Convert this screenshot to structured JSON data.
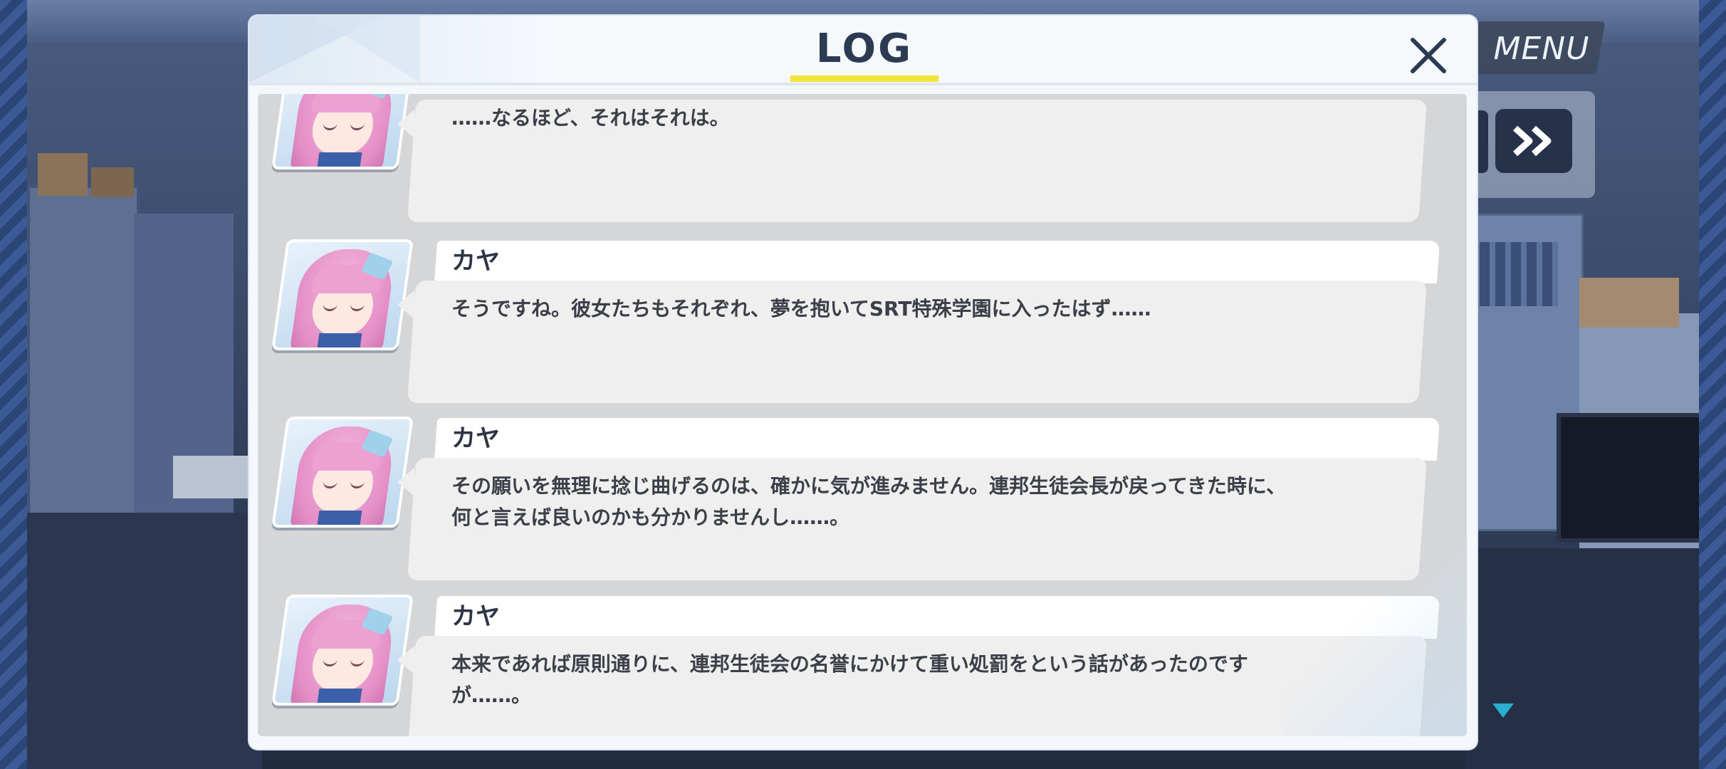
{
  "game_ui": {
    "menu_label": "MENU",
    "skip_icon": "double-chevron-right-icon",
    "scroll_indicator_icon": "triangle-down-icon",
    "accent_color": "#2aaed0"
  },
  "log": {
    "title": "LOG",
    "close_icon": "close-icon",
    "title_underline_color": "#f2e33a",
    "entries": [
      {
        "speaker": "",
        "text": "……なるほど、それはそれは。"
      },
      {
        "speaker": "カヤ",
        "text": "そうですね。彼女たちもそれぞれ、夢を抱いてSRT特殊学園に入ったはず……"
      },
      {
        "speaker": "カヤ",
        "text": "その願いを無理に捻じ曲げるのは、確かに気が進みません。連邦生徒会長が戻ってきた時に、\n何と言えば良いのかも分かりませんし……。"
      },
      {
        "speaker": "カヤ",
        "text": "本来であれば原則通りに、連邦生徒会の名誉にかけて重い処罰をという話があったのです\nが……。"
      }
    ]
  }
}
